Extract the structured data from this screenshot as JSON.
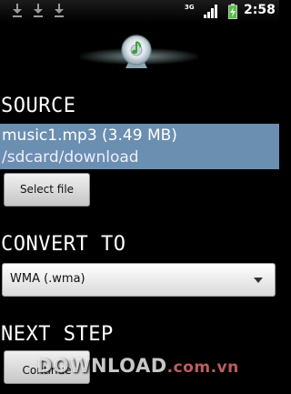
{
  "status_bar": {
    "icons": [
      "download-icon",
      "download-icon",
      "download-icon"
    ],
    "network": "3G",
    "time": "2:58"
  },
  "app": {
    "logo": "music-disc-webcam-logo"
  },
  "source": {
    "heading": "SOURCE",
    "file_name": "music1.mp3 (3.49 MB)",
    "file_path": "/sdcard/download",
    "select_button": "Select file"
  },
  "convert": {
    "heading": "CONVERT TO",
    "selected_format": "WMA (.wma)"
  },
  "next_step": {
    "heading": "NEXT STEP",
    "continue_button": "Continue"
  },
  "watermark": {
    "main": "DOWNLOAD",
    "domain": ".com.vn"
  },
  "colors": {
    "file_highlight": "#6b8fb0",
    "battery": "#4cc43a"
  }
}
